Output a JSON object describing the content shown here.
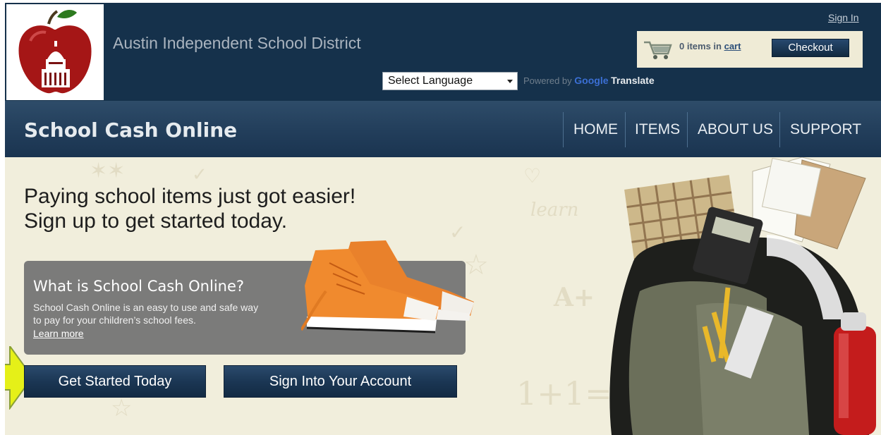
{
  "header": {
    "district_name": "Austin Independent School District",
    "sign_in": "Sign In",
    "cart": {
      "count_text": "0 items in",
      "link": "cart",
      "checkout": "Checkout"
    },
    "language": {
      "selected": "Select Language",
      "powered_by": "Powered by",
      "google": "Google",
      "translate": "Translate"
    }
  },
  "nav": {
    "brand": "School Cash Online",
    "items": [
      {
        "label": "HOME"
      },
      {
        "label": "ITEMS"
      },
      {
        "label": "ABOUT US"
      },
      {
        "label": "SUPPORT"
      }
    ]
  },
  "hero": {
    "headline_line1": "Paying school items just got easier!",
    "headline_line2": "Sign up to get started today.",
    "info": {
      "title": "What is School Cash Online?",
      "body_line1": "School Cash Online is an easy to use and safe way",
      "body_line2": "to pay for your children’s school fees.",
      "learn_more": "Learn more"
    },
    "buttons": {
      "get_started": "Get Started Today",
      "sign_in_account": "Sign Into Your Account"
    }
  },
  "colors": {
    "header_bg": "#15314b",
    "nav_bg": "#233f5c",
    "hero_bg": "#f1eedc",
    "button_bg": "#1a3552",
    "arrow": "#e5f018"
  },
  "icons": [
    "apple-logo-icon",
    "cart-icon",
    "dropdown-arrow-icon",
    "pointer-arrow-icon"
  ]
}
